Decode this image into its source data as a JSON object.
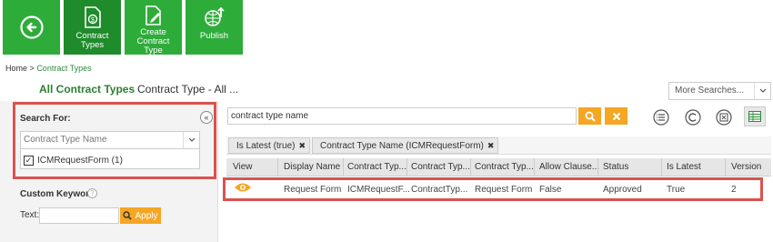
{
  "toolbar": {
    "back_icon": "back-arrow-icon",
    "buttons": [
      {
        "label": "Contract\nTypes",
        "icon": "contract-types-icon"
      },
      {
        "label": "Create\nContract\nType",
        "icon": "create-contract-type-icon"
      },
      {
        "label": "Publish",
        "icon": "publish-icon"
      }
    ],
    "accent": "#2eac3a",
    "active_accent": "#1f8b2b"
  },
  "breadcrumb": {
    "home": "Home",
    "separator": ">",
    "current": "Contract Types"
  },
  "view": {
    "title": "All Contract Types",
    "subtitle": "Contract Type - All ..."
  },
  "more_searches": {
    "label": "More Searches..."
  },
  "left_panel": {
    "search_for_label": "Search For:",
    "select_placeholder": "Contract Type Name",
    "facet_checked": true,
    "facet_label": "ICMRequestForm (1)",
    "custom_keyword_label": "Custom Keyword",
    "text_label": "Text:",
    "apply_label": "Apply"
  },
  "search": {
    "value": "contract type name",
    "search_icon": "search-icon",
    "clear_icon": "clear-x-icon"
  },
  "view_icons": [
    "list-icon",
    "copyright-icon",
    "export-icon",
    "grid-icon"
  ],
  "filters": [
    {
      "label": "Is Latest (true)"
    },
    {
      "label": "Contract Type Name (ICMRequestForm)"
    }
  ],
  "table": {
    "columns": [
      "View",
      "Display Name",
      "Contract Typ...",
      "Contract Typ...",
      "Contract Typ...",
      "Allow Clause...",
      "Status",
      "Is Latest",
      "Version"
    ],
    "rows": [
      [
        "",
        "Request Form",
        "ICMRequestF...",
        "ContractTyp...",
        "Request Form",
        "False",
        "Approved",
        "True",
        "2"
      ]
    ]
  },
  "colors": {
    "highlight_border": "#d9534f",
    "action_orange": "#f5a623",
    "title_green": "#2e7d32"
  }
}
